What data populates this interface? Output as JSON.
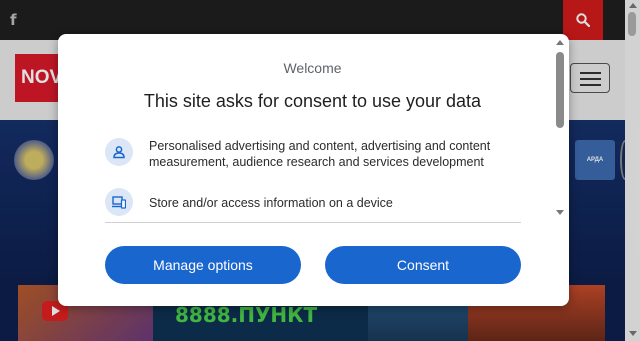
{
  "site": {
    "facebook_glyph": "f",
    "logo_text": "NOV",
    "right_team_badge": "АРДА",
    "promo_text": "8888.ПУНКТ"
  },
  "dialog": {
    "welcome": "Welcome",
    "title": "This site asks for consent to use your data",
    "purposes": [
      {
        "icon": "person-icon",
        "text": "Personalised advertising and content, advertising and content measurement, audience research and services development"
      },
      {
        "icon": "devices-icon",
        "text": "Store and/or access information on a device"
      }
    ],
    "buttons": {
      "manage": "Manage options",
      "consent": "Consent"
    }
  },
  "colors": {
    "accent": "#1a66cf",
    "topbar": "#1f1f1f",
    "search_button": "#d21b1b",
    "logo": "#d8192a",
    "icon_bg": "#dbe6f7"
  }
}
